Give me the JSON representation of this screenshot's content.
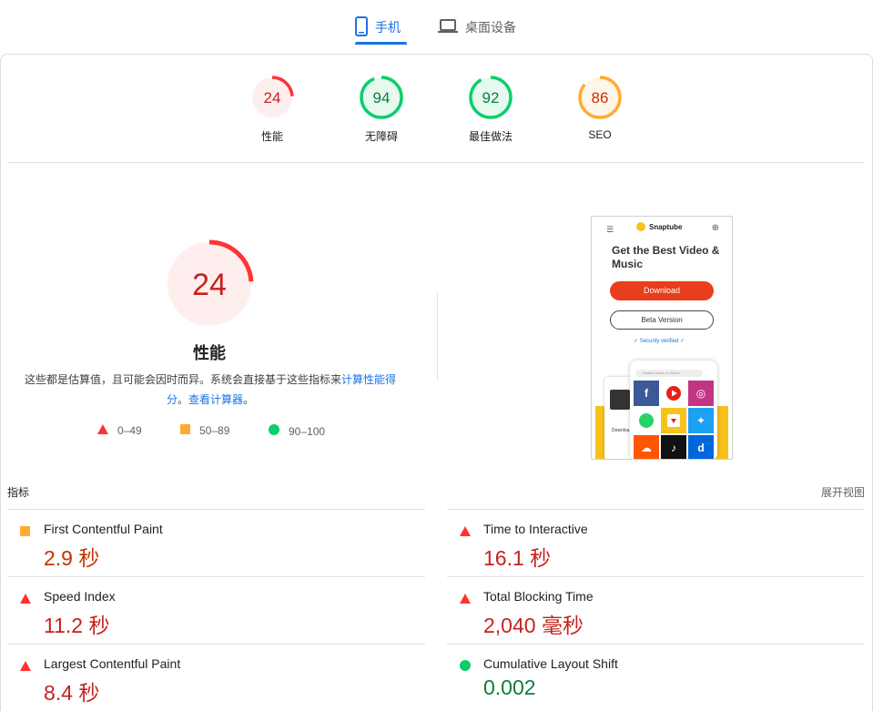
{
  "tabs": [
    {
      "label": "手机",
      "icon": "smartphone-icon",
      "active": true
    },
    {
      "label": "桌面设备",
      "icon": "laptop-icon",
      "active": false
    }
  ],
  "categories": [
    {
      "score": 24,
      "label": "性能",
      "rating": "fail"
    },
    {
      "score": 94,
      "label": "无障碍",
      "rating": "pass"
    },
    {
      "score": 92,
      "label": "最佳做法",
      "rating": "pass"
    },
    {
      "score": 86,
      "label": "SEO",
      "rating": "average"
    }
  ],
  "performance": {
    "score": 24,
    "title": "性能",
    "desc_text": "这些都是估算值，且可能会因时而异。系统会直接基于这些指标来",
    "calc_link": "计算性能得分",
    "desc_sep": "。",
    "calculator_link": "查看计算器",
    "desc_end": "。"
  },
  "legend": [
    {
      "range": "0–49",
      "shape": "triangle",
      "color": "#f33"
    },
    {
      "range": "50–89",
      "shape": "square",
      "color": "#fa3"
    },
    {
      "range": "90–100",
      "shape": "circle",
      "color": "#0c6"
    }
  ],
  "screenshot": {
    "brand": "Snaptube",
    "headline": "Get the Best Video & Music",
    "download_label": "Download",
    "beta_label": "Beta Version",
    "security_text": "Security verified",
    "search_placeholder": "Search music & videos",
    "side_text": "Downloa"
  },
  "metrics": {
    "header": "指标",
    "expand_label": "展开视图",
    "left": [
      {
        "name": "First Contentful Paint",
        "value": "2.9 秒",
        "rating": "average"
      },
      {
        "name": "Speed Index",
        "value": "11.2 秒",
        "rating": "fail"
      },
      {
        "name": "Largest Contentful Paint",
        "value": "8.4 秒",
        "rating": "fail"
      }
    ],
    "right": [
      {
        "name": "Time to Interactive",
        "value": "16.1 秒",
        "rating": "fail"
      },
      {
        "name": "Total Blocking Time",
        "value": "2,040 毫秒",
        "rating": "fail"
      },
      {
        "name": "Cumulative Layout Shift",
        "value": "0.002",
        "rating": "pass"
      }
    ]
  },
  "colors": {
    "fail": "#ff3333",
    "average": "#ffaa33",
    "pass": "#0cce6b",
    "accent": "#1a73e8"
  }
}
